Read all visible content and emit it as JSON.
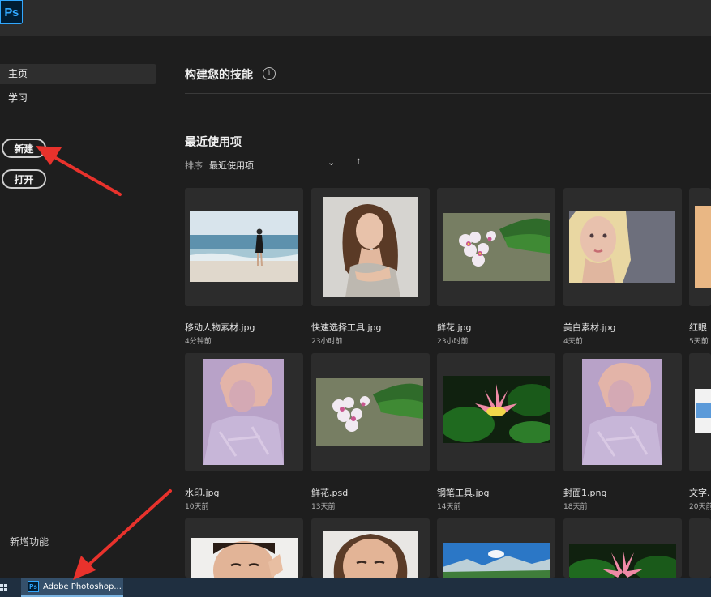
{
  "app": {
    "logo_text": "Ps"
  },
  "sidebar": {
    "nav": [
      {
        "label": "主页",
        "active": true
      },
      {
        "label": "学习",
        "active": false
      }
    ],
    "new_button": "新建",
    "open_button": "打开",
    "whats_new": "新增功能"
  },
  "main": {
    "skills_title": "构建您的技能",
    "info_icon_glyph": "i",
    "recent_title": "最近使用项",
    "sort_label": "排序",
    "sort_value": "最近使用项",
    "sort_chevron": "⌄",
    "sort_direction_glyph": "↑",
    "files": [
      {
        "name": "移动人物素材.jpg",
        "time": "4分钟前"
      },
      {
        "name": "快速选择工具.jpg",
        "time": "23小时前"
      },
      {
        "name": "鲜花.jpg",
        "time": "23小时前"
      },
      {
        "name": "美白素材.jpg",
        "time": "4天前"
      },
      {
        "name": "红眼",
        "time": "5天前"
      },
      {
        "name": "水印.jpg",
        "time": "10天前"
      },
      {
        "name": "鲜花.psd",
        "time": "13天前"
      },
      {
        "name": "钢笔工具.jpg",
        "time": "14天前"
      },
      {
        "name": "封面1.png",
        "time": "18天前"
      },
      {
        "name": "文字.",
        "time": "20天前"
      }
    ]
  },
  "taskbar": {
    "app_icon_text": "Ps",
    "app_label": "Adobe Photoshop..."
  },
  "colors": {
    "background": "#1e1e1e",
    "topbar": "#2c2c2c",
    "card": "#2c2c2c",
    "accent_ps": "#31a8ff",
    "arrow": "#e8322c",
    "taskbar": "#1f2f40"
  }
}
